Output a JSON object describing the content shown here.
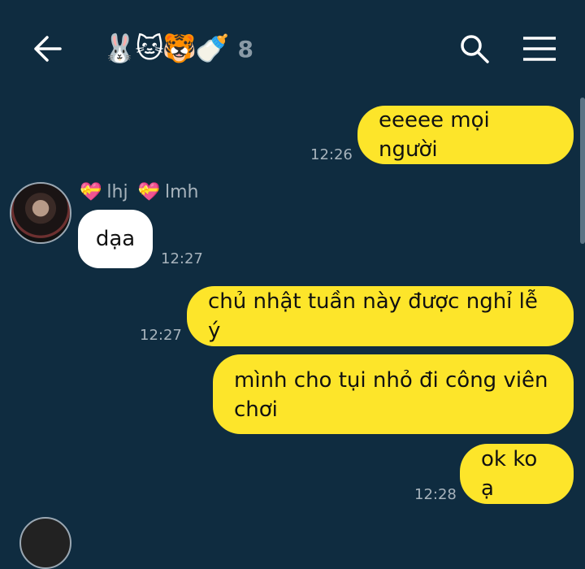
{
  "header": {
    "title_emoji": "🐰🐱🐯🍼",
    "member_count": "8"
  },
  "messages": [
    {
      "text": "eeeee mọi người",
      "time": "12:26"
    },
    {
      "sender_names": [
        "lhj",
        "lmh"
      ],
      "text": "dạa",
      "time": "12:27"
    },
    {
      "text": "chủ nhật tuần này được nghỉ lễ ý",
      "time": "12:27"
    },
    {
      "text": "mình cho tụi nhỏ đi công viên chơi"
    },
    {
      "text": "ok ko ạ",
      "time": "12:28"
    }
  ],
  "colors": {
    "background": "#0f2c40",
    "my_bubble": "#fde52a",
    "their_bubble": "#ffffff"
  },
  "icons": [
    "back-arrow-icon",
    "search-icon",
    "menu-icon",
    "heart-icon"
  ]
}
